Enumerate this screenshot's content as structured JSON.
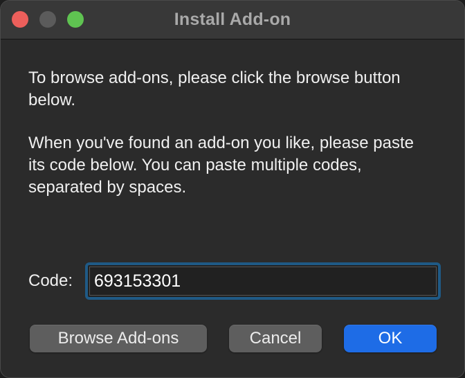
{
  "window": {
    "title": "Install Add-on"
  },
  "content": {
    "paragraph1": "To browse add-ons, please click the browse button below.",
    "paragraph2": "When you've found an add-on you like, please paste its code below. You can paste multiple codes, separated by spaces."
  },
  "code": {
    "label": "Code:",
    "value": "693153301"
  },
  "buttons": {
    "browse": "Browse Add-ons",
    "cancel": "Cancel",
    "ok": "OK"
  },
  "colors": {
    "accent": "#1e6ce6",
    "focus_ring": "#1f5a86",
    "close": "#ec5f5b",
    "zoom": "#5fc351"
  }
}
